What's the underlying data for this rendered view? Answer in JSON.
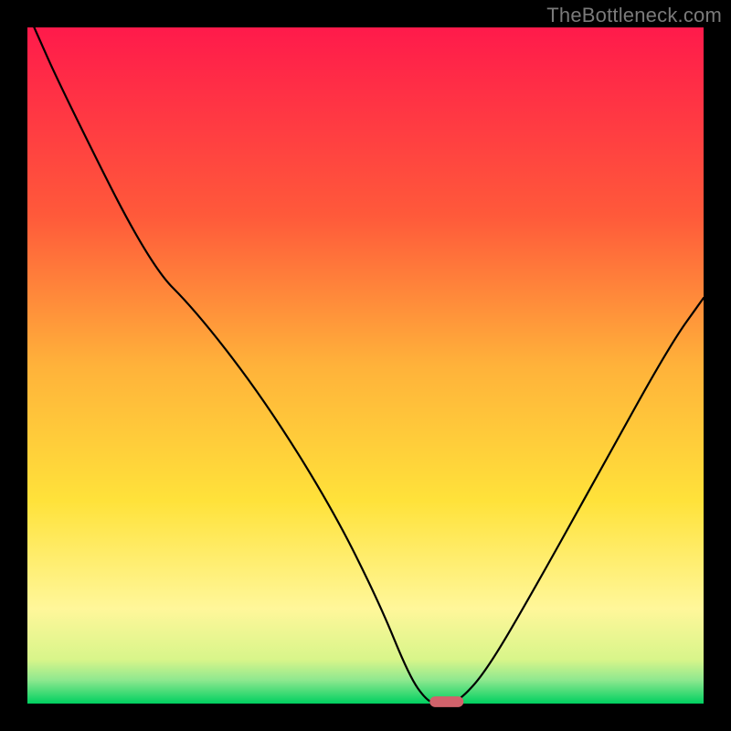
{
  "watermark": "TheBottleneck.com",
  "chart_data": {
    "type": "line",
    "title": "",
    "xlabel": "",
    "ylabel": "",
    "xlim": [
      0,
      100
    ],
    "ylim": [
      0,
      100
    ],
    "background_gradient_stops": [
      {
        "offset": 0.0,
        "color": "#ff1a4b"
      },
      {
        "offset": 0.28,
        "color": "#ff5a3a"
      },
      {
        "offset": 0.5,
        "color": "#ffb23a"
      },
      {
        "offset": 0.7,
        "color": "#ffe23a"
      },
      {
        "offset": 0.86,
        "color": "#fff79a"
      },
      {
        "offset": 0.935,
        "color": "#d8f58a"
      },
      {
        "offset": 0.965,
        "color": "#8fe88f"
      },
      {
        "offset": 1.0,
        "color": "#00d060"
      }
    ],
    "series": [
      {
        "name": "bottleneck-curve",
        "x": [
          1,
          5,
          18,
          25,
          35,
          45,
          52,
          56.5,
          59,
          60.5,
          62,
          64,
          68,
          75,
          85,
          95,
          100
        ],
        "y": [
          100,
          91,
          65,
          58,
          45,
          29,
          15,
          4,
          0.5,
          0,
          0,
          0.5,
          5,
          17,
          35,
          53,
          60
        ]
      }
    ],
    "marker": {
      "name": "optimal-range-marker",
      "x_center": 62,
      "y": 0,
      "width_x": 5,
      "height_y": 1.6,
      "color": "#d1626b"
    },
    "axes_color": "#000000",
    "curve_color": "#000000",
    "curve_width": 2.2
  }
}
